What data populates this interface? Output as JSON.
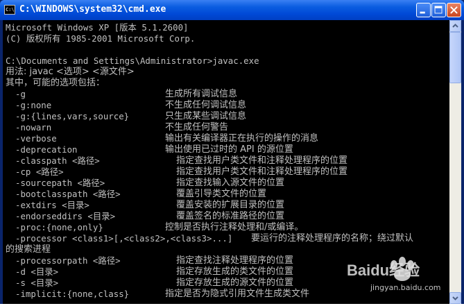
{
  "window": {
    "title": "C:\\WINDOWS\\system32\\cmd.exe",
    "icon": "cmd-icon",
    "buttons": {
      "minimize": "minimize-icon",
      "maximize": "maximize-icon",
      "close": "close-icon"
    }
  },
  "console": {
    "header": [
      "Microsoft Windows XP [版本 5.1.2600]",
      "(C) 版权所有 1985-2001 Microsoft Corp."
    ],
    "prompt": "C:\\Documents and Settings\\Administrator>javac.exe",
    "usage": "用法: javac <选项> <源文件>",
    "options_intro": "其中，可能的选项包括：",
    "options": [
      {
        "flag": "-g",
        "desc": "生成所有调试信息"
      },
      {
        "flag": "-g:none",
        "desc": "不生成任何调试信息"
      },
      {
        "flag": "-g:{lines,vars,source}",
        "desc": "只生成某些调试信息"
      },
      {
        "flag": "-nowarn",
        "desc": "不生成任何警告"
      },
      {
        "flag": "-verbose",
        "desc": "输出有关编译器正在执行的操作的消息"
      },
      {
        "flag": "-deprecation",
        "desc": "输出使用已过时的 API 的源位置"
      },
      {
        "flag": "-classpath <路径>",
        "desc": "指定查找用户类文件和注释处理程序的位置"
      },
      {
        "flag": "-cp <路径>",
        "desc": "指定查找用户类文件和注释处理程序的位置"
      },
      {
        "flag": "-sourcepath <路径>",
        "desc": "指定查找输入源文件的位置"
      },
      {
        "flag": "-bootclasspath <路径>",
        "desc": "覆盖引导类文件的位置"
      },
      {
        "flag": "-extdirs <目录>",
        "desc": "覆盖安装的扩展目录的位置"
      },
      {
        "flag": "-endorseddirs <目录>",
        "desc": "覆盖签名的标准路径的位置"
      },
      {
        "flag": "-proc:{none,only}",
        "desc": "控制是否执行注释处理和/或编译。"
      },
      {
        "flag": "-processor <class1>[,<class2>,<class3>...]",
        "desc": "要运行的注释处理程序的名称；绕过默认"
      },
      {
        "flag": "",
        "desc": "的搜索进程"
      },
      {
        "flag": "-processorpath <路径>",
        "desc": "指定查找注释处理程序的位置"
      },
      {
        "flag": "-d <目录>",
        "desc": "指定存放生成的类文件的位置"
      },
      {
        "flag": "-s <目录>",
        "desc": "指定存放生成的源文件的位置"
      },
      {
        "flag": "-implicit:{none,class}",
        "desc": "指定是否为隐式引用文件生成类文件"
      }
    ]
  },
  "watermark": {
    "brand": "Baidu经验",
    "url": "jingyan.baidu.com"
  },
  "colors": {
    "console_bg": "#000000",
    "console_fg": "#c0c0c0",
    "titlebar": "#0049d6"
  }
}
